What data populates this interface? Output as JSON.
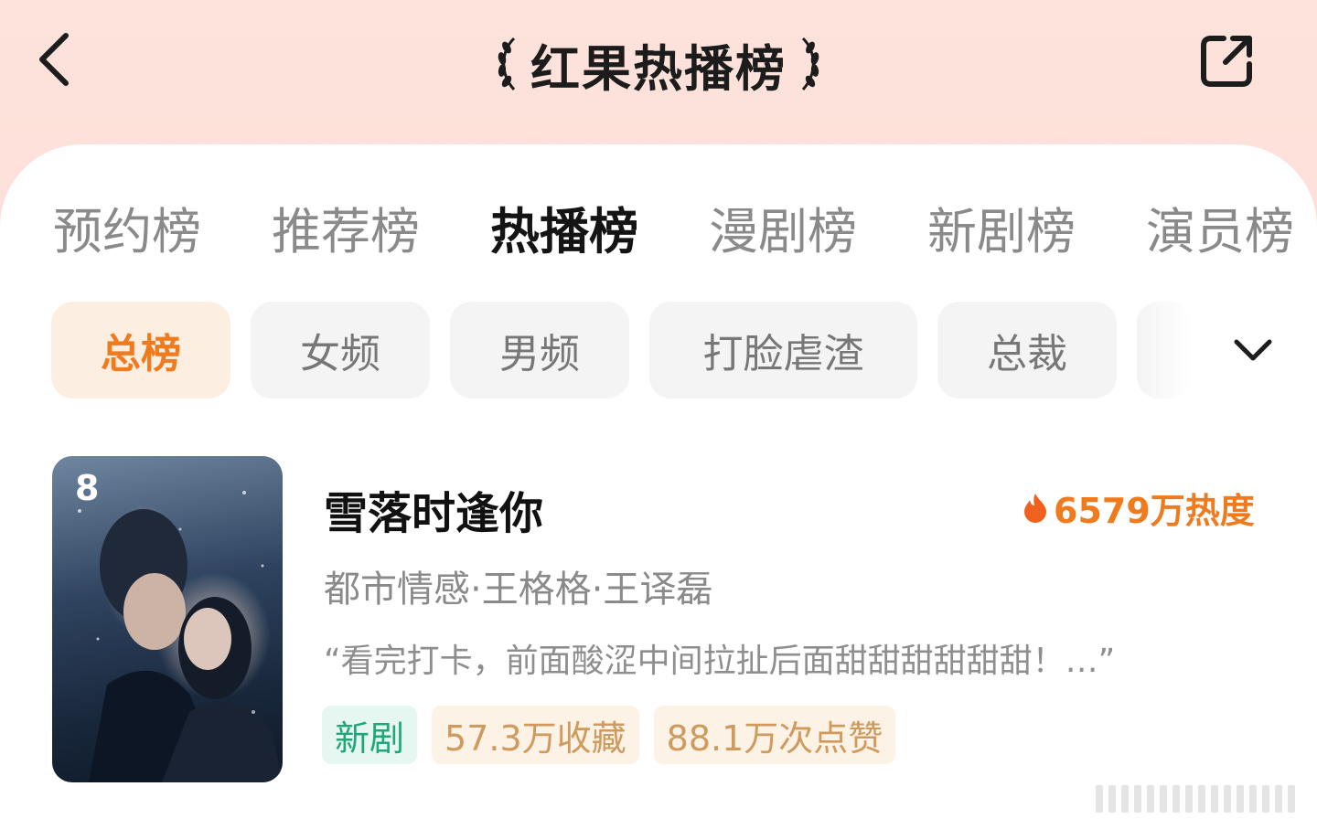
{
  "header": {
    "title": "红果热播榜",
    "back_icon": "chevron-left-icon",
    "share_icon": "share-icon"
  },
  "tabs": [
    {
      "label": "预约榜",
      "active": false
    },
    {
      "label": "推荐榜",
      "active": false
    },
    {
      "label": "热播榜",
      "active": true
    },
    {
      "label": "漫剧榜",
      "active": false
    },
    {
      "label": "新剧榜",
      "active": false
    },
    {
      "label": "演员榜",
      "active": false
    }
  ],
  "chips": [
    {
      "label": "总榜",
      "active": true
    },
    {
      "label": "女频",
      "active": false
    },
    {
      "label": "男频",
      "active": false
    },
    {
      "label": "打脸虐渣",
      "active": false
    },
    {
      "label": "总裁",
      "active": false
    }
  ],
  "item": {
    "rank": "8",
    "title": "雪落时逢你",
    "heat": "6579万热度",
    "meta": "都市情感·王格格·王译磊",
    "quote": "“看完打卡，前面酸涩中间拉扯后面甜甜甜甜甜甜！…”",
    "tags": {
      "new": "新剧",
      "favorites": "57.3万收藏",
      "likes": "88.1万次点赞"
    }
  },
  "colors": {
    "accent": "#f07b1f",
    "tag_green": "#1fa777",
    "tag_gold": "#cf9a5c"
  }
}
